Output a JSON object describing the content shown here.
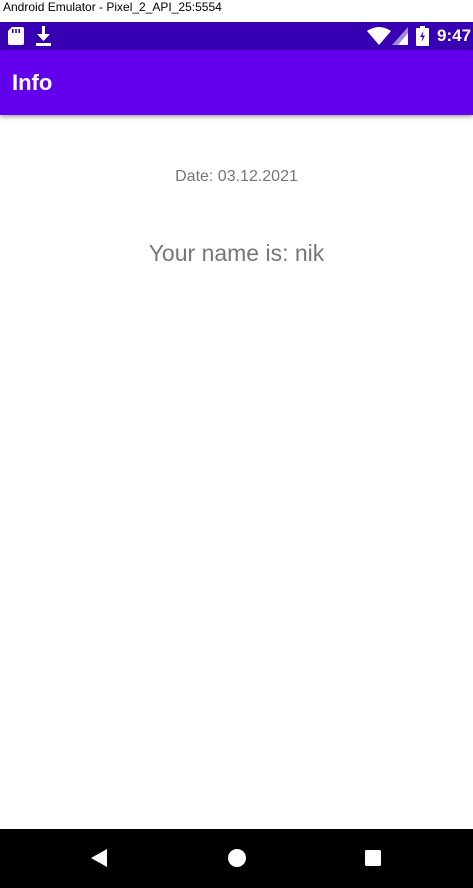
{
  "window": {
    "title": "Android Emulator - Pixel_2_API_25:5554"
  },
  "status_bar": {
    "time": "9:47",
    "color": "#3700b3",
    "icons": [
      "sd-card-icon",
      "download-icon",
      "wifi-icon",
      "signal-icon",
      "battery-icon"
    ]
  },
  "app_bar": {
    "title": "Info",
    "color": "#6200ee"
  },
  "content": {
    "date_text": "Date: 03.12.2021",
    "name_text": "Your name is: nik"
  },
  "nav_bar": {
    "buttons": [
      "back-icon",
      "home-icon",
      "recents-icon"
    ]
  }
}
